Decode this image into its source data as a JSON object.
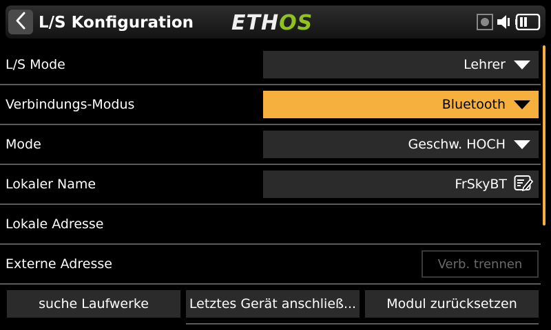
{
  "header": {
    "title": "L/S Konfiguration",
    "logo_part1": "ETH",
    "logo_part2": "OS",
    "icons": [
      "chevron-left-icon",
      "sd-card-icon",
      "speaker-icon",
      "battery-icon"
    ]
  },
  "rows": {
    "ls_mode": {
      "label": "L/S Mode",
      "value": "Lehrer"
    },
    "connection_mode": {
      "label": "Verbindungs-Modus",
      "value": "Bluetooth"
    },
    "mode": {
      "label": "Mode",
      "value": "Geschw. HOCH"
    },
    "local_name": {
      "label": "Lokaler Name",
      "value": "FrSkyBT"
    },
    "local_address": {
      "label": "Lokale Adresse"
    },
    "external_address": {
      "label": "Externe Adresse",
      "button": "Verb. trennen"
    }
  },
  "buttons": {
    "search": "suche Laufwerke",
    "connect_last": "Letztes Gerät anschließ...",
    "reset_module": "Modul zurücksetzen"
  },
  "colors": {
    "accent": "#f6b03d",
    "logo_green": "#8fc21d",
    "field_bg": "#2b2b2b",
    "divider": "#5c5c5c"
  }
}
